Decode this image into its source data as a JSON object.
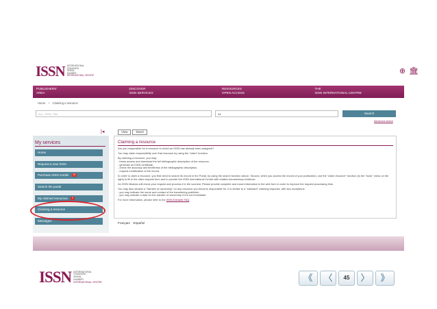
{
  "logo": {
    "mark": "ISSN",
    "lines": [
      "INTERNATIONAL",
      "STANDARD",
      "SERIAL",
      "NUMBER",
      "INTERNATIONAL CENTRE"
    ]
  },
  "header_icons": {
    "globe": "globe-icon",
    "building": "institution-icon",
    "globe_glyph": "⊕",
    "building_glyph": "🏛"
  },
  "nav": {
    "items": [
      {
        "line1": "PUBLISHERS'",
        "line2": "AREA"
      },
      {
        "line1": "DISCOVER",
        "line2": "ISSN SERVICES"
      },
      {
        "line1": "RESOURCES",
        "line2": "OPEN ACCESS"
      },
      {
        "line1": "THE",
        "line2": "ISSN INTERNATIONAL CENTRE"
      }
    ]
  },
  "breadcrumb": {
    "home": "Home",
    "separator": ">",
    "current": "Claiming a resource"
  },
  "search": {
    "placeholder": "ALL_ISSN_Title",
    "filter_value": "All",
    "button_label": "Search",
    "advanced_label": "Advanced search"
  },
  "collapse_glyph": "|◂",
  "tabs": {
    "view": "View",
    "devel": "Devel"
  },
  "sidebar": {
    "title": "My services",
    "items": [
      {
        "label": "Home",
        "badge": ""
      },
      {
        "label": "Request a new ISSN",
        "badge": ""
      },
      {
        "label": "Purchase ISSN credits",
        "badge": "10"
      },
      {
        "label": "Search the portal",
        "badge": ""
      },
      {
        "label": "My claimed resources",
        "badge": "2"
      },
      {
        "label": "Claiming a resource",
        "badge": ""
      },
      {
        "label": "Messages",
        "badge": ""
      }
    ]
  },
  "content": {
    "title": "Claiming a resource",
    "paragraphs": [
      "Are you responsible for a resource to which an ISSN has already been assigned?",
      "You may claim responsibility over that resource by using the \"claim\" function.",
      "By claiming a resource, you may:",
      "- freely access and download the full bibliographic description of the resource,",
      "- generate an ISSN certificate,",
      "- check the accuracy and timeliness of the bibliographic description,",
      "- request modification of the record.",
      "In order to claim a resource, you first need to search its record in the Portal, by using the search function above. Second, when you access the record of your publication, use the \"claim resource\" function (in the \"tools\" menu on the right) to fill in the claim request form and to provide the ISSN International Centre with related documentary evidence.",
      "An ISSN librarian will check your request and process it in the soonest. Please provide complete and exact information in the web form in order to improve the request processing time.",
      "You may also declare a \"transfer of ownership\" on any resource you become responsible for. It is similar to a \"standard\" claiming requests, with two exceptions:",
      "- you may indicate the name and contact of the transferring publisher,",
      "- you may indicate a date for the transfer of ownership if it is not immediate."
    ],
    "faq_prefix": "For more information, please refer to the",
    "faq_link": "ISSN Extranet FAQ",
    "faq_suffix": "."
  },
  "languages": {
    "fr": "Français",
    "es": "Español"
  },
  "pager": {
    "first": "《",
    "prev": "〈",
    "page": "45",
    "next": "〉",
    "last": "》"
  },
  "colors": {
    "brand": "#8a1a55",
    "button": "#4f8397",
    "badge": "#d9302a",
    "annotation": "#d6242d"
  }
}
